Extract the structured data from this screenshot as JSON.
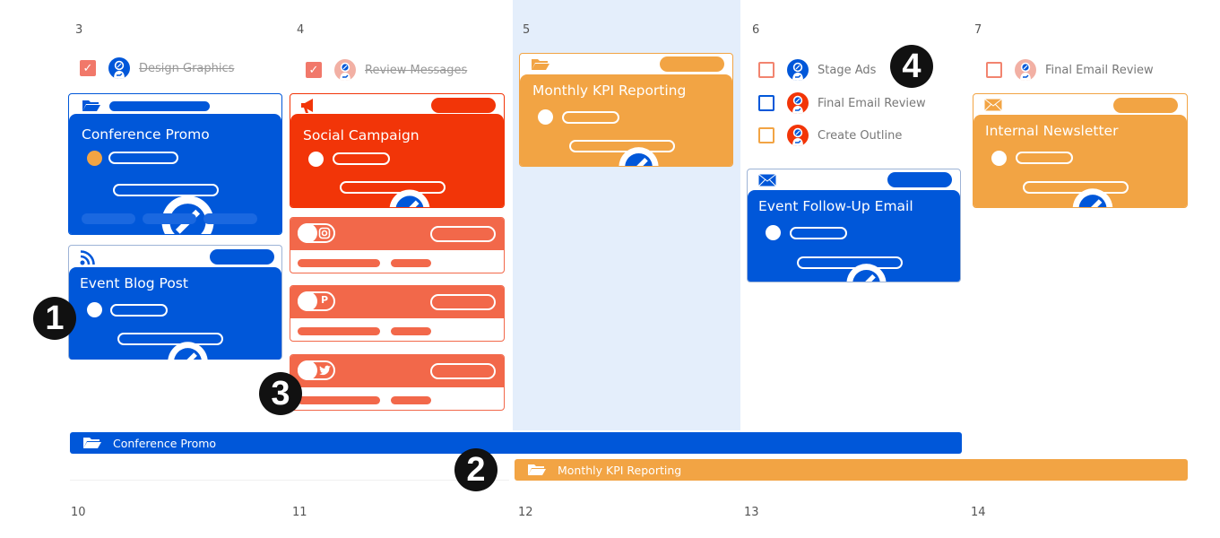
{
  "colors": {
    "blue": "#0057d9",
    "red": "#f23508",
    "coral": "#f2684a",
    "orange": "#f2a444",
    "today_bg": "#e4eefb",
    "done_check": "#f1786a"
  },
  "week1": {
    "days": [
      {
        "num": "3"
      },
      {
        "num": "4"
      },
      {
        "num": "5",
        "today": true
      },
      {
        "num": "6"
      },
      {
        "num": "7"
      }
    ]
  },
  "week2": {
    "days": [
      {
        "num": "10"
      },
      {
        "num": "11"
      },
      {
        "num": "12"
      },
      {
        "num": "13"
      },
      {
        "num": "14"
      }
    ]
  },
  "tasks": {
    "d3": [
      {
        "label": "Design Graphics",
        "done": true,
        "avatar": "blue"
      }
    ],
    "d4": [
      {
        "label": "Review Messages",
        "done": true,
        "avatar": "pink"
      }
    ],
    "d6": [
      {
        "label": "Stage Ads",
        "done": false,
        "checkbox_color": "coral",
        "avatar": "blue"
      },
      {
        "label": "Final Email Review",
        "done": false,
        "checkbox_color": "blue",
        "avatar": "red"
      },
      {
        "label": "Create Outline",
        "done": false,
        "checkbox_color": "orange",
        "avatar": "red"
      }
    ],
    "d7": [
      {
        "label": "Final Email Review",
        "done": false,
        "checkbox_color": "coral",
        "avatar": "pink"
      }
    ]
  },
  "cards": {
    "conference_promo": {
      "title": "Conference Promo",
      "type_icon": "folder-icon",
      "color": "blue",
      "status_dot": "orange"
    },
    "event_blog_post": {
      "title": "Event Blog Post",
      "type_icon": "rss-icon",
      "color": "blue"
    },
    "social_campaign": {
      "title": "Social Campaign",
      "type_icon": "megaphone-icon",
      "color": "red"
    },
    "monthly_kpi": {
      "title": "Monthly KPI Reporting",
      "type_icon": "folder-icon",
      "color": "orange"
    },
    "event_follow_up": {
      "title": "Event Follow-Up Email",
      "type_icon": "mail-icon",
      "color": "blue"
    },
    "internal_newsletter": {
      "title": "Internal Newsletter",
      "type_icon": "mail-icon",
      "color": "orange"
    }
  },
  "social_posts": [
    {
      "network": "instagram",
      "icon": "instagram-icon"
    },
    {
      "network": "pinterest",
      "icon": "pinterest-icon"
    },
    {
      "network": "twitter",
      "icon": "twitter-icon"
    }
  ],
  "timeline_bars": [
    {
      "label": "Conference Promo",
      "icon": "folder-icon",
      "color": "blue",
      "start_day": "3",
      "end_day": "6"
    },
    {
      "label": "Monthly KPI Reporting",
      "icon": "folder-icon",
      "color": "orange",
      "start_day": "5",
      "end_day": "7"
    }
  ],
  "callouts": [
    "1",
    "2",
    "3",
    "4"
  ]
}
